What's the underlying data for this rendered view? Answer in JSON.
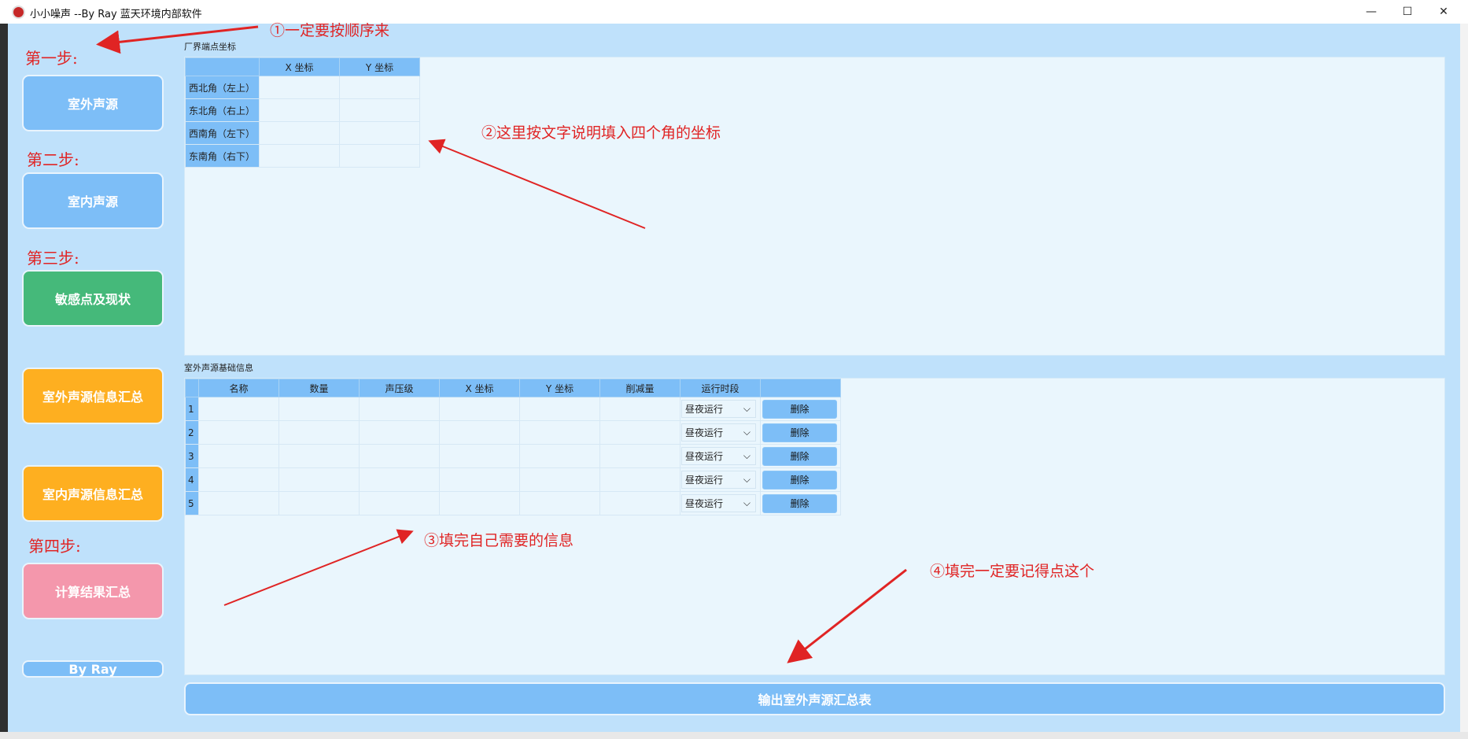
{
  "window": {
    "title": "小小噪声  --By Ray  蓝天环境内部软件",
    "minimize": "—",
    "maximize": "☐",
    "close": "✕"
  },
  "sidebar": {
    "step1": "第一步:",
    "step2": "第二步:",
    "step3": "第三步:",
    "step4": "第四步:",
    "btn_outdoor": "室外声源",
    "btn_indoor": "室内声源",
    "btn_sensitive": "敏感点及现状",
    "btn_outdoor_summary": "室外声源信息汇总",
    "btn_indoor_summary": "室内声源信息汇总",
    "btn_result": "计算结果汇总",
    "by": "By Ray"
  },
  "colors": {
    "accent": "#7dbef7",
    "green": "#45b97a",
    "orange": "#feaf20",
    "pink": "#f497ac",
    "annotation": "#e02424"
  },
  "boundary": {
    "label": "厂界端点坐标",
    "headers": [
      "",
      "X 坐标",
      "Y 坐标"
    ],
    "rows": [
      "西北角（左上）",
      "东北角（右上）",
      "西南角（左下）",
      "东南角（右下）"
    ]
  },
  "sources": {
    "label": "室外声源基础信息",
    "headers": [
      "",
      "名称",
      "数量",
      "声压级",
      "X 坐标",
      "Y 坐标",
      "削减量",
      "运行时段",
      ""
    ],
    "rows": [
      "1",
      "2",
      "3",
      "4",
      "5"
    ],
    "select_value": "昼夜运行",
    "delete_label": "删除"
  },
  "output_button": "输出室外声源汇总表",
  "annotations": {
    "a1": "①一定要按顺序来",
    "a2": "②这里按文字说明填入四个角的坐标",
    "a3": "③填完自己需要的信息",
    "a4": "④填完一定要记得点这个"
  }
}
